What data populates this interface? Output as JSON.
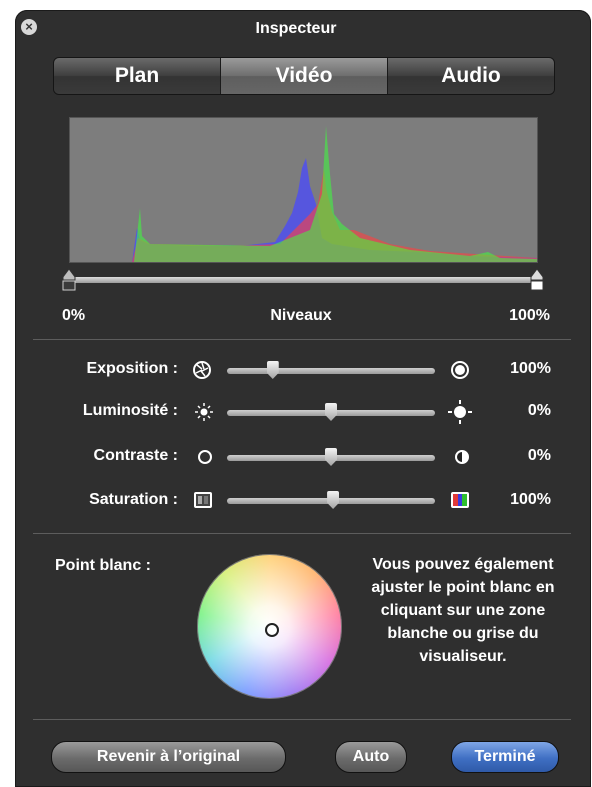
{
  "window": {
    "title": "Inspecteur"
  },
  "tabs": [
    {
      "label": "Plan",
      "active": false
    },
    {
      "label": "Vidéo",
      "active": true
    },
    {
      "label": "Audio",
      "active": false
    }
  ],
  "levels": {
    "min_label": "0%",
    "title": "Niveaux",
    "max_label": "100%",
    "min_value": 0,
    "max_value": 1
  },
  "adjustments": [
    {
      "label": "Exposition :",
      "value": "100%",
      "position": 0.22
    },
    {
      "label": "Luminosité :",
      "value": "0%",
      "position": 0.5
    },
    {
      "label": "Contraste :",
      "value": "0%",
      "position": 0.5
    },
    {
      "label": "Saturation :",
      "value": "100%",
      "position": 0.51
    }
  ],
  "white_point": {
    "label": "Point blanc :",
    "hint": "Vous pouvez également ajuster le point blanc en cliquant sur une zone blanche ou grise du visualiseur."
  },
  "buttons": {
    "revert": "Revenir à l’original",
    "auto": "Auto",
    "done": "Terminé"
  },
  "colors": {
    "panel": "#2f2f2f",
    "accent": "#3f6fc3",
    "hist_red": "#ff3c3c",
    "hist_green": "#3cff3c",
    "hist_blue": "#4a4aff"
  }
}
